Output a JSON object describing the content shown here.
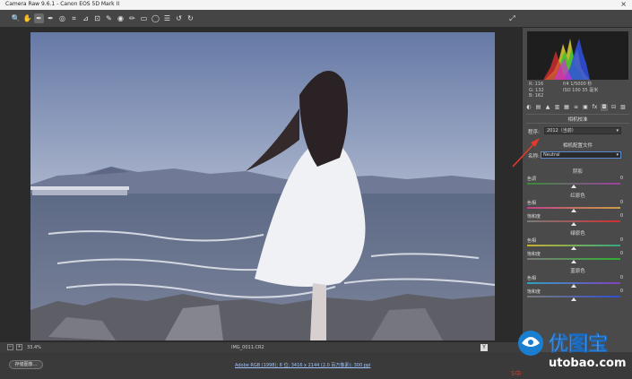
{
  "window": {
    "title": "Camera Raw 9.6.1 - Canon EOS 5D Mark II",
    "close_glyph": "×"
  },
  "toolbar": {
    "tool_icons": [
      "zoom-icon",
      "hand-icon",
      "white-balance-icon",
      "color-sampler-icon",
      "targeted-adjustment-icon",
      "crop-icon",
      "straighten-icon",
      "transform-icon",
      "spot-removal-icon",
      "red-eye-icon",
      "adjustment-brush-icon",
      "graduated-filter-icon",
      "radial-filter-icon",
      "preferences-icon",
      "rotate-ccw-icon",
      "rotate-cw-icon"
    ],
    "tool_glyphs": [
      "🔍",
      "✋",
      "✒",
      "✒",
      "◎",
      "⌗",
      "⊿",
      "⊡",
      "✎",
      "◉",
      "✏",
      "▭",
      "◯",
      "☰",
      "↺",
      "↻"
    ],
    "active_tool_index": 2,
    "fullscreen_glyph": "⤢"
  },
  "histogram": {
    "readout_left": [
      "R:  116",
      "G:  132",
      "B:  162"
    ],
    "readout_right": [
      "f/4   1/5000 秒",
      "ISO 100   35 毫米"
    ]
  },
  "panel": {
    "tab_glyphs": [
      "◐",
      "▤",
      "▲",
      "▥",
      "▦",
      "≡",
      "▣",
      "fx",
      "◘",
      "⊟",
      "▧"
    ],
    "active_tab_index": 8,
    "section_title": "相机校准",
    "process_label": "程序:",
    "process_value": "2012（当前）",
    "profile_section_title": "相机配置文件",
    "name_label": "名称:",
    "name_value": "Neutral",
    "caret": "▾",
    "groups": [
      {
        "title": "阴影",
        "sliders": [
          {
            "label": "色调",
            "value": "0",
            "position": 0.5,
            "gradient": [
              "#3a8a3a",
              "#a040a0"
            ]
          }
        ]
      },
      {
        "title": "红原色",
        "sliders": [
          {
            "label": "色相",
            "value": "0",
            "position": 0.5,
            "gradient": [
              "#c0408a",
              "#c8a040"
            ]
          },
          {
            "label": "饱和度",
            "value": "0",
            "position": 0.5,
            "gradient": [
              "#7a7a7a",
              "#d03030"
            ]
          }
        ]
      },
      {
        "title": "绿原色",
        "sliders": [
          {
            "label": "色相",
            "value": "0",
            "position": 0.5,
            "gradient": [
              "#c8b030",
              "#30a880"
            ]
          },
          {
            "label": "饱和度",
            "value": "0",
            "position": 0.5,
            "gradient": [
              "#7a7a7a",
              "#30b030"
            ]
          }
        ]
      },
      {
        "title": "蓝原色",
        "sliders": [
          {
            "label": "色相",
            "value": "0",
            "position": 0.5,
            "gradient": [
              "#30a0c0",
              "#8040c0"
            ]
          },
          {
            "label": "饱和度",
            "value": "0",
            "position": 0.5,
            "gradient": [
              "#7a7a7a",
              "#3050d0"
            ]
          }
        ]
      }
    ]
  },
  "status": {
    "zoom": "33.4%",
    "filename": "IMG_0011.CR2",
    "zoom_out": "−",
    "zoom_in": "+",
    "y_button": "Y"
  },
  "bottom": {
    "save_label": "存储图像...",
    "workflow_text": "Adobe RGB (1998); 8 位; 3416 x 2144 (2.0 百万像素); 300 ppi"
  },
  "watermark": {
    "brand_cn": "优图宝",
    "brand_url": "utobao.com",
    "small_mark": "S中"
  }
}
